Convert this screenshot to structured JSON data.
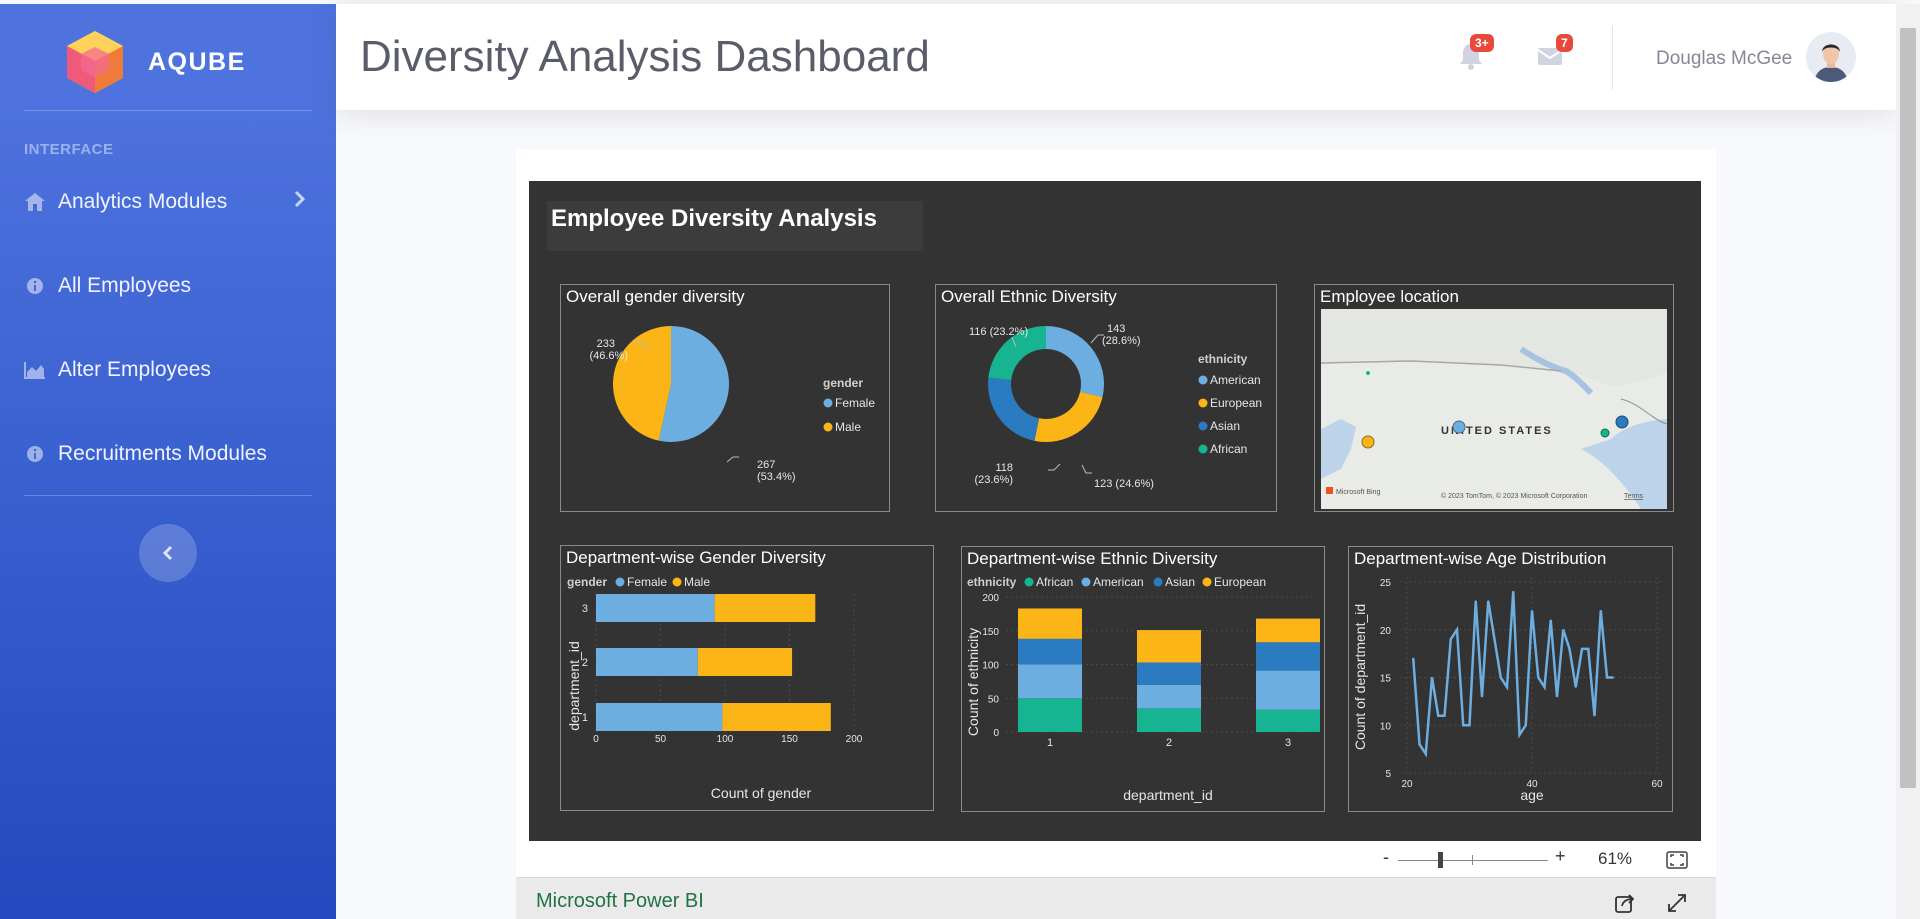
{
  "sidebar": {
    "brand": "AQUBE",
    "heading": "INTERFACE",
    "items": [
      {
        "label": "Analytics Modules",
        "icon": "home-icon",
        "has_chevron": true
      },
      {
        "label": "All Employees",
        "icon": "info-icon"
      },
      {
        "label": "Alter Employees",
        "icon": "area-chart-icon"
      },
      {
        "label": "Recruitments Modules",
        "icon": "info-icon"
      }
    ],
    "toggle_icon": "chevron-left-icon"
  },
  "topbar": {
    "title": "Diversity Analysis Dashboard",
    "alerts_badge": "3+",
    "messages_badge": "7",
    "user_name": "Douglas McGee"
  },
  "report": {
    "title": "Employee Diversity Analysis",
    "visuals": {
      "gender": {
        "title": "Overall gender diversity",
        "legend_title": "gender"
      },
      "ethnic": {
        "title": "Overall Ethnic Diversity",
        "legend_title": "ethnicity"
      },
      "location": {
        "title": "Employee location",
        "map_label": "UNITED STATES",
        "logo_text": "Microsoft Bing",
        "copyright": "© 2023 TomTom, © 2023 Microsoft Corporation",
        "terms": "Terms"
      },
      "dept_gender": {
        "title": "Department-wise Gender Diversity",
        "legend_title": "gender"
      },
      "dept_ethnic": {
        "title": "Department-wise Ethnic Diversity",
        "legend_title": "ethnicity"
      },
      "dept_age": {
        "title": "Department-wise Age Distribution"
      }
    }
  },
  "zoom": {
    "minus": "-",
    "plus": "+",
    "level": "61%",
    "value_pct": 61
  },
  "footer": {
    "link": "Microsoft Power BI"
  },
  "colors": {
    "female": "#6caee0",
    "male": "#fbb516",
    "american": "#6caee0",
    "european": "#fbb516",
    "asian": "#2a7bc0",
    "african": "#16b490"
  },
  "chart_data": [
    {
      "type": "pie",
      "title": "Overall gender diversity",
      "legend_title": "gender",
      "slices": [
        {
          "label": "Female",
          "value": 267,
          "pct_label": "267",
          "pct_text": "(53.4%)"
        },
        {
          "label": "Male",
          "value": 233,
          "pct_label": "233",
          "pct_text": "(46.6%)"
        }
      ]
    },
    {
      "type": "pie",
      "subtype": "donut",
      "title": "Overall Ethnic Diversity",
      "legend_title": "ethnicity",
      "slices": [
        {
          "label": "American",
          "value": 143,
          "pct_label": "143",
          "pct_text": "(28.6%)"
        },
        {
          "label": "European",
          "value": 123,
          "pct_label": "123 (24.6%)",
          "pct_text": ""
        },
        {
          "label": "Asian",
          "value": 118,
          "pct_label": "118",
          "pct_text": "(23.6%)"
        },
        {
          "label": "African",
          "value": 116,
          "pct_label": "116 (23.2%)",
          "pct_text": ""
        }
      ]
    },
    {
      "type": "bar",
      "orientation": "horizontal",
      "stacked": true,
      "title": "Department-wise Gender Diversity",
      "legend_title": "gender",
      "categories": [
        "1",
        "2",
        "3"
      ],
      "series": [
        {
          "name": "Female",
          "values": [
            98,
            79,
            92
          ]
        },
        {
          "name": "Male",
          "values": [
            84,
            73,
            78
          ]
        }
      ],
      "xlabel": "Count of gender",
      "ylabel": "department_id",
      "xlim": [
        0,
        200
      ],
      "xticks": [
        0,
        50,
        100,
        150,
        200
      ]
    },
    {
      "type": "bar",
      "stacked": true,
      "title": "Department-wise Ethnic Diversity",
      "legend_title": "ethnicity",
      "categories": [
        "1",
        "2",
        "3"
      ],
      "series": [
        {
          "name": "African",
          "values": [
            50,
            35,
            33
          ]
        },
        {
          "name": "American",
          "values": [
            50,
            35,
            58
          ]
        },
        {
          "name": "Asian",
          "values": [
            38,
            33,
            42
          ]
        },
        {
          "name": "European",
          "values": [
            45,
            48,
            35
          ]
        }
      ],
      "xlabel": "department_id",
      "ylabel": "Count of ethnicity",
      "ylim": [
        0,
        200
      ],
      "yticks": [
        0,
        50,
        100,
        150,
        200
      ]
    },
    {
      "type": "line",
      "title": "Department-wise Age Distribution",
      "x": [
        21,
        22,
        23,
        24,
        25,
        26,
        27,
        28,
        29,
        30,
        31,
        32,
        33,
        34,
        35,
        36,
        37,
        38,
        39,
        40,
        41,
        42,
        43,
        44,
        45,
        46,
        47,
        48,
        49,
        50,
        51,
        52,
        53
      ],
      "y": [
        17,
        8,
        7,
        15,
        11,
        11,
        19,
        20,
        10,
        10,
        23,
        13,
        23,
        19,
        15,
        14,
        24,
        9,
        10,
        22,
        15,
        14,
        21,
        13,
        20,
        18,
        14,
        18,
        18,
        11,
        22,
        15,
        15
      ],
      "xlabel": "age",
      "ylabel": "Count of department_id",
      "xlim": [
        20,
        60
      ],
      "ylim": [
        5,
        25
      ],
      "xticks": [
        20,
        40,
        60
      ],
      "yticks": [
        5,
        10,
        15,
        20,
        25
      ]
    }
  ]
}
